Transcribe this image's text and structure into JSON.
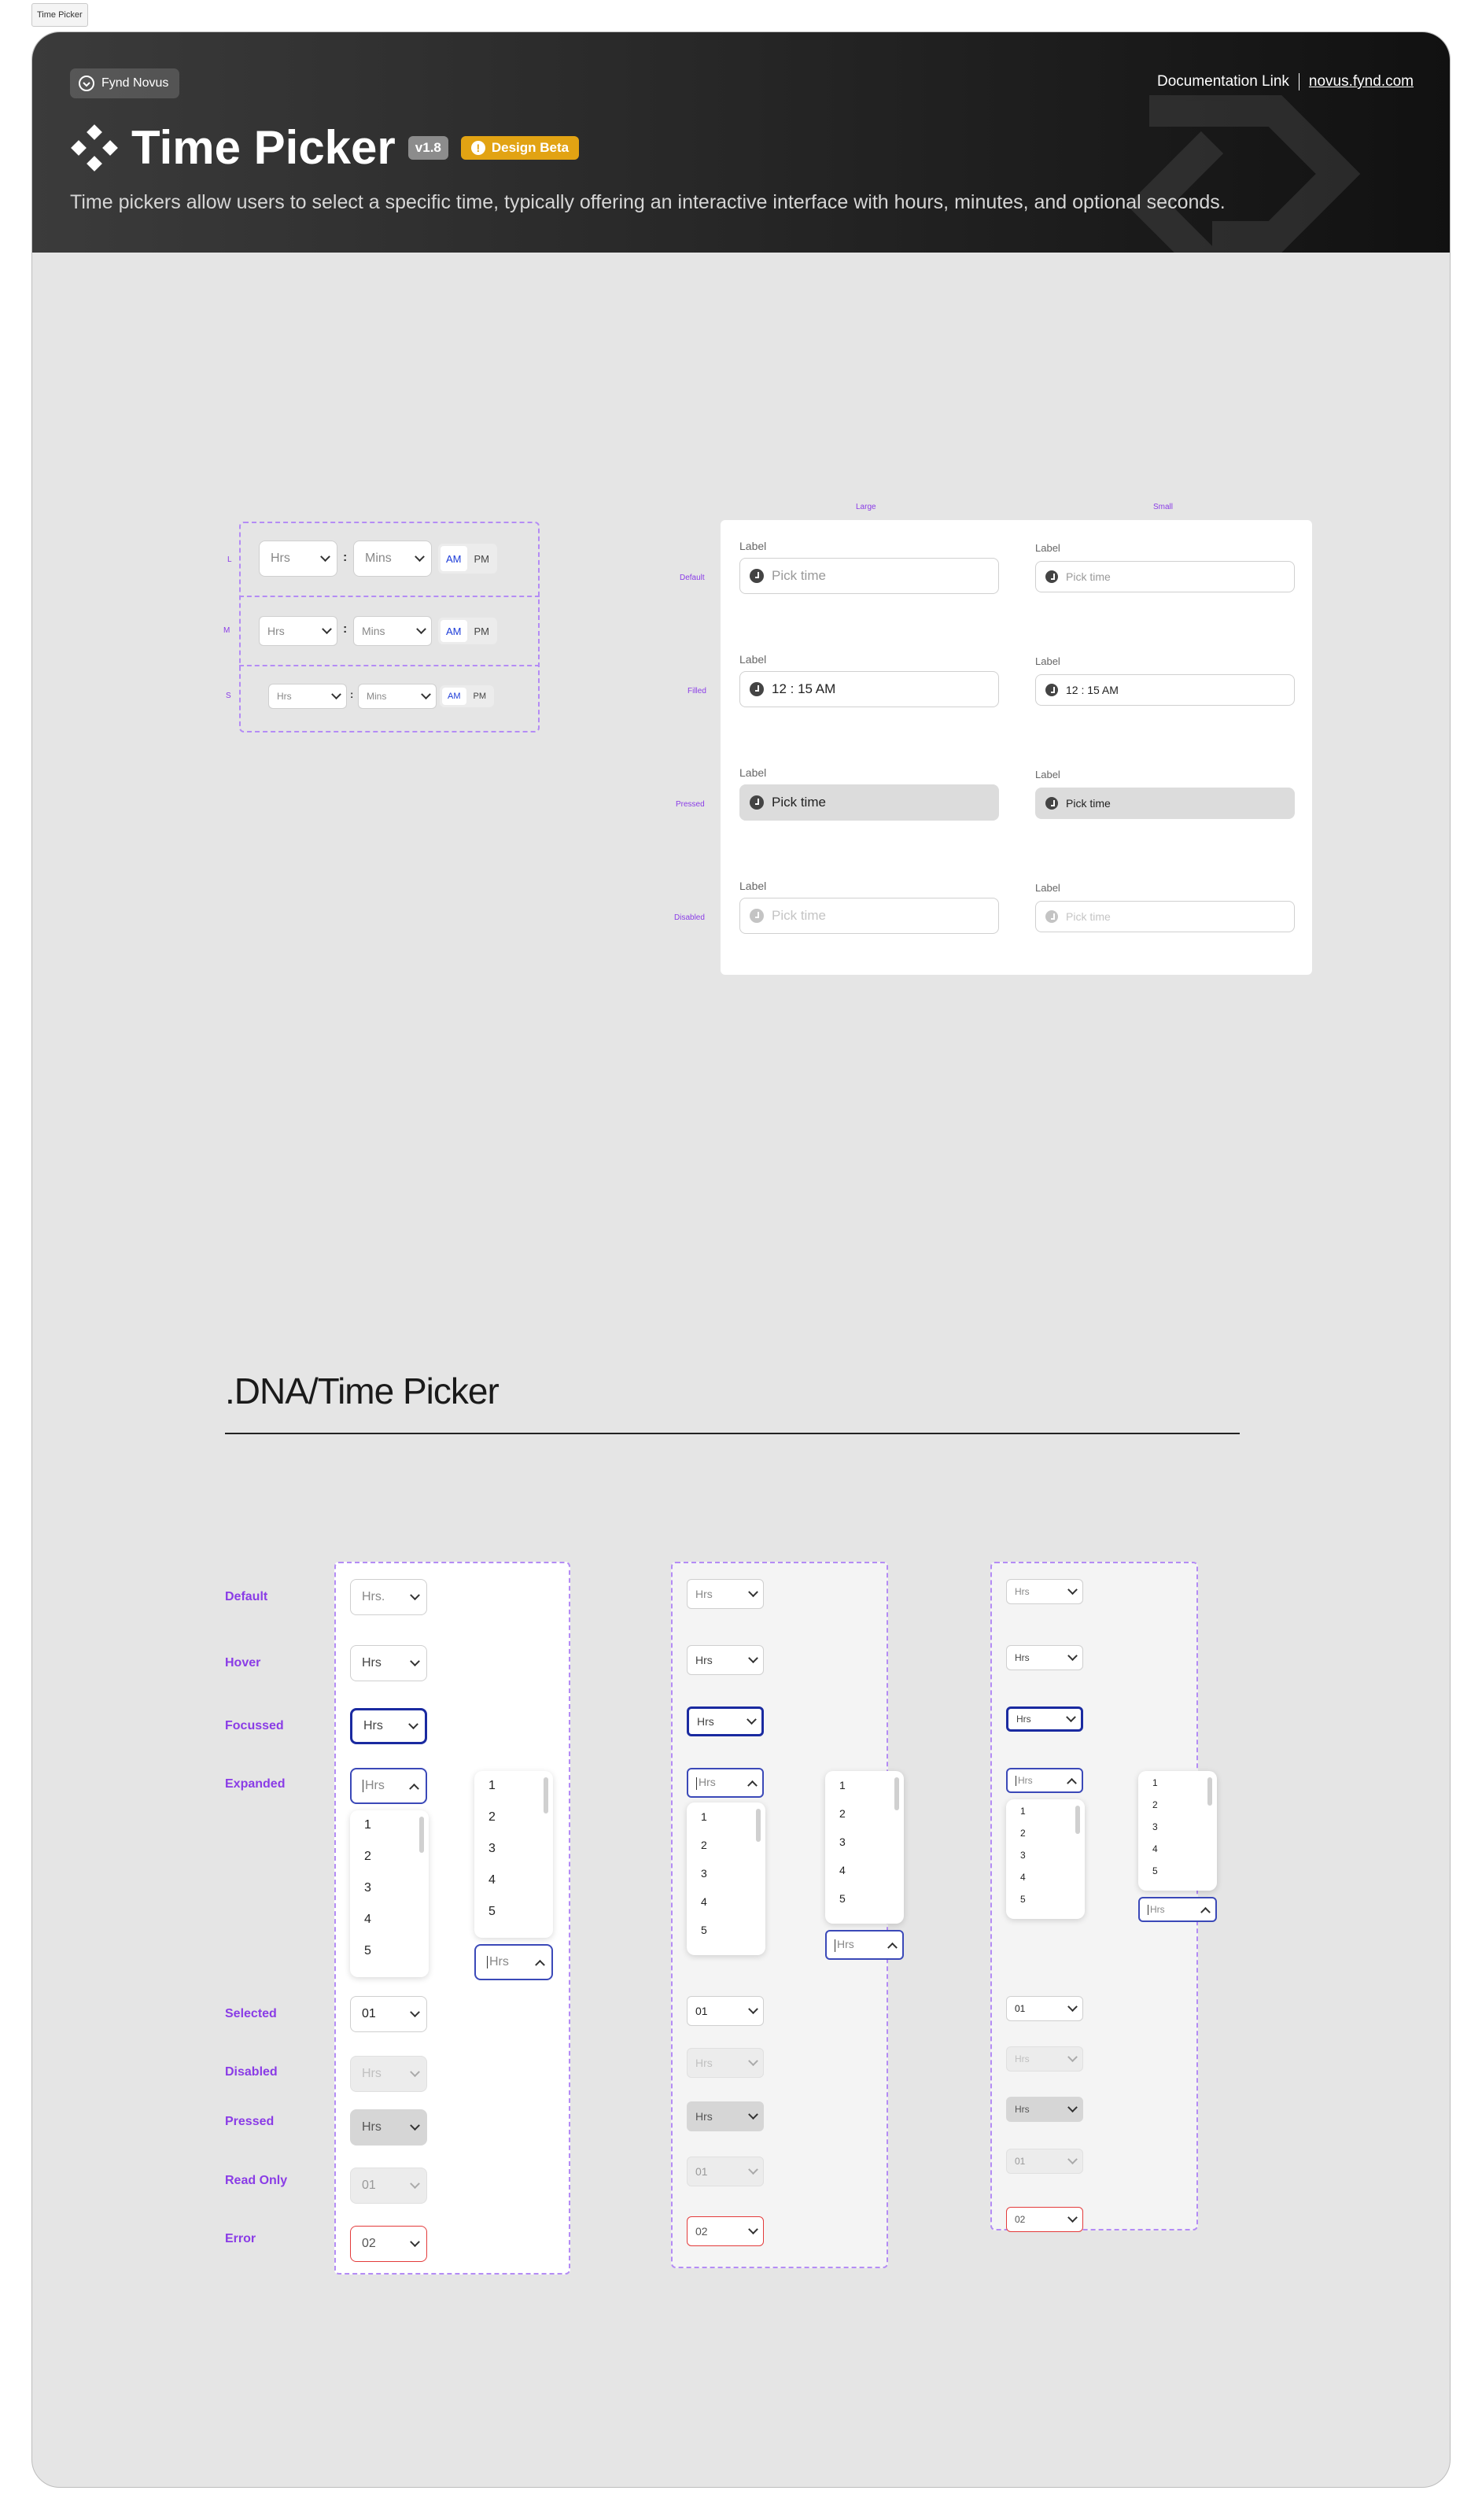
{
  "frame_tag": "Time Picker",
  "header": {
    "brand": "Fynd Novus",
    "doc_label": "Documentation Link",
    "doc_url": "novus.fynd.com",
    "title": "Time Picker",
    "version": "v1.8",
    "badge": "Design Beta",
    "description": "Time pickers allow users to select a specific time, typically offering an interactive interface with hours, minutes, and optional seconds."
  },
  "size_variants": {
    "rows": [
      {
        "label": "L",
        "hrs": "Hrs",
        "mins": "Mins",
        "am": "AM",
        "pm": "PM"
      },
      {
        "label": "M",
        "hrs": "Hrs",
        "mins": "Mins",
        "am": "AM",
        "pm": "PM"
      },
      {
        "label": "S",
        "hrs": "Hrs",
        "mins": "Mins",
        "am": "AM",
        "pm": "PM"
      }
    ],
    "colon": ":"
  },
  "field_states": {
    "col_large": "Large",
    "col_small": "Small",
    "rows": [
      {
        "state": "Default",
        "label": "Label",
        "value": "Pick time"
      },
      {
        "state": "Filled",
        "label": "Label",
        "value": "12 : 15 AM"
      },
      {
        "state": "Pressed",
        "label": "Label",
        "value": "Pick time"
      },
      {
        "state": "Disabled",
        "label": "Label",
        "value": "Pick time"
      }
    ]
  },
  "dna": {
    "title": ".DNA/Time Picker",
    "state_labels": [
      "Default",
      "Hover",
      "Focussed",
      "Expanded",
      "Selected",
      "Disabled",
      "Pressed",
      "Read Only",
      "Error"
    ],
    "values": {
      "default": "Hrs.",
      "default_short": "Hrs",
      "hover": "Hrs",
      "focussed": "Hrs",
      "expanded": "Hrs",
      "selected": "01",
      "disabled": "Hrs",
      "pressed": "Hrs",
      "readonly": "01",
      "error": "02"
    },
    "options": [
      "1",
      "2",
      "3",
      "4",
      "5"
    ]
  },
  "colors": {
    "accent": "#8a3ce6",
    "focus": "#1a2aa0",
    "error": "#e33b3b",
    "beta": "#e2a313"
  }
}
